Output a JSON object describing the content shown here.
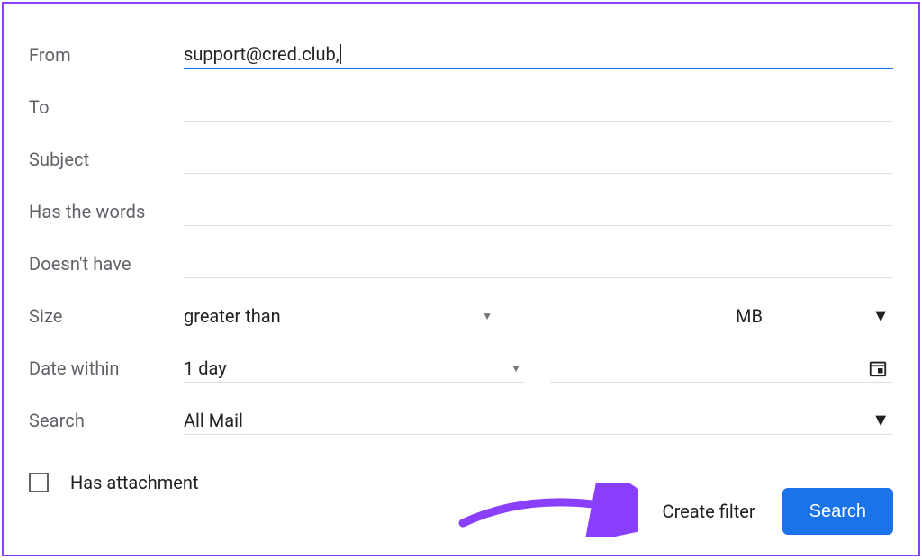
{
  "labels": {
    "from": "From",
    "to": "To",
    "subject": "Subject",
    "has_words": "Has the words",
    "doesnt_have": "Doesn't have",
    "size": "Size",
    "date_within": "Date within",
    "search": "Search",
    "has_attachment": "Has attachment"
  },
  "values": {
    "from": "support@cred.club,",
    "size_operator": "greater than",
    "size_unit": "MB",
    "date_range": "1 day",
    "search_in": "All Mail"
  },
  "buttons": {
    "create_filter": "Create filter",
    "search": "Search"
  }
}
